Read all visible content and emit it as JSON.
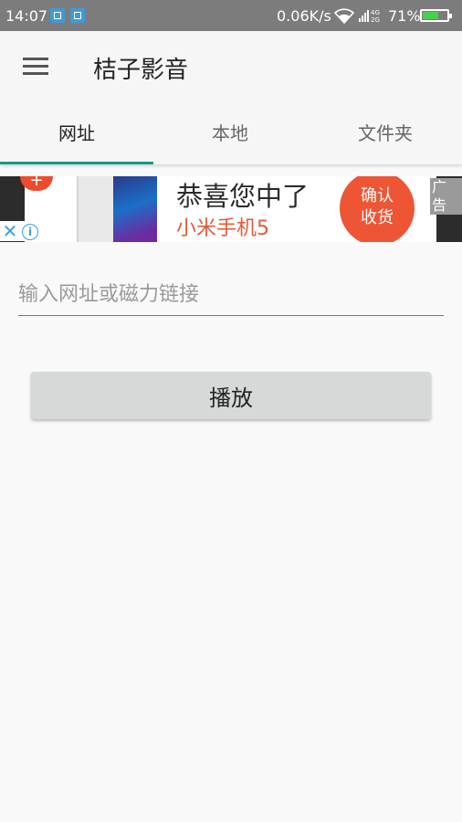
{
  "status_bar": {
    "time": "14:07",
    "net_speed": "0.06K/s",
    "signal_text": "4G\n2G",
    "battery_pct": "71%",
    "battery_level": 0.71,
    "icons": [
      "screenshot-notification-icon",
      "clipboard-notification-icon",
      "wifi-icon",
      "signal-icon",
      "battery-icon"
    ]
  },
  "appbar": {
    "title": "桔子影音",
    "menu_icon": "hamburger-menu-icon"
  },
  "tabs": [
    {
      "label": "网址",
      "selected": true
    },
    {
      "label": "本地",
      "selected": false
    },
    {
      "label": "文件夹",
      "selected": false
    }
  ],
  "ad": {
    "headline": "恭喜您中了",
    "subline": "小米手机5",
    "cta": "确认\n收货",
    "tag": "广告",
    "close_symbol": "✕",
    "info_symbol": "i"
  },
  "url_input": {
    "value": "",
    "placeholder": "输入网址或磁力链接"
  },
  "play_button": {
    "label": "播放"
  },
  "colors": {
    "accent": "#159b88",
    "status_bar": "#7c7c7c",
    "ad_cta": "#ee5534",
    "ad_sub_text": "#e45a3a",
    "battery_fill": "#4ccd4c"
  }
}
